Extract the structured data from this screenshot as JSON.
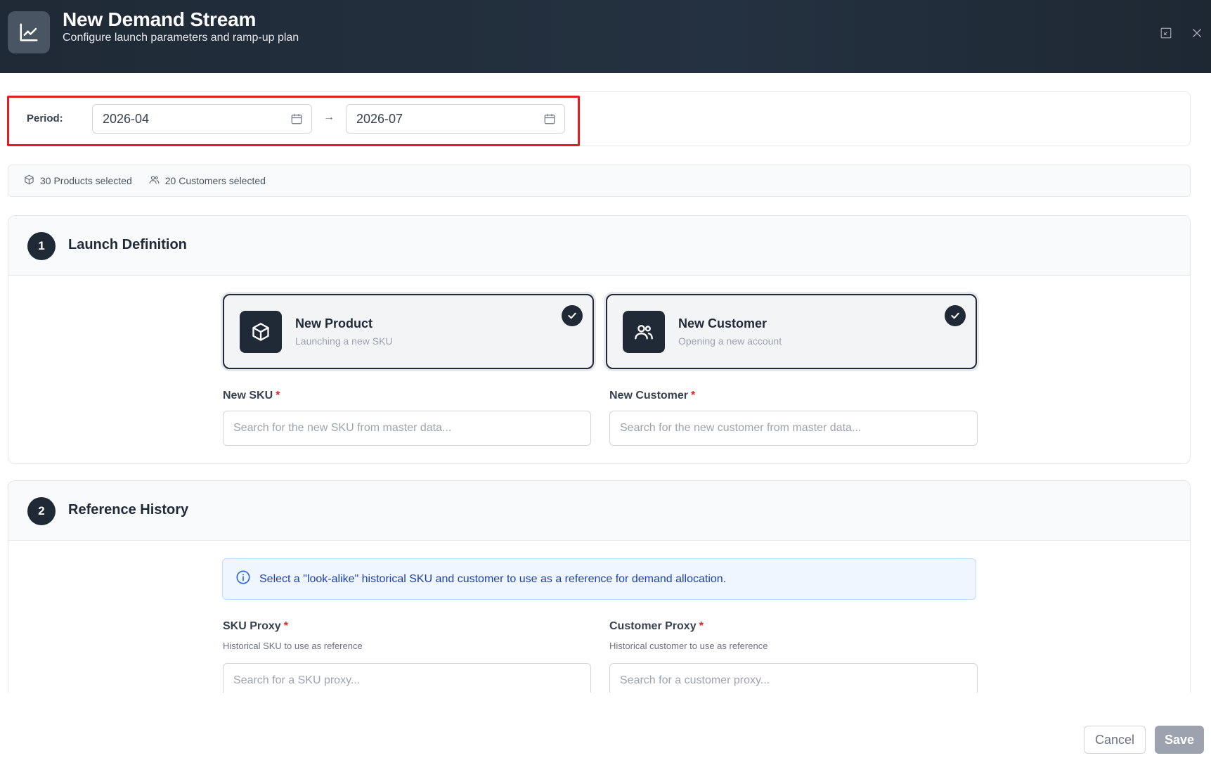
{
  "header": {
    "title": "New Demand Stream",
    "subtitle": "Configure launch parameters and ramp-up plan",
    "icon": "trend-chart-icon"
  },
  "period": {
    "label": "Period:",
    "start": "2026-04",
    "end": "2026-07",
    "separator": "→"
  },
  "selection": {
    "products": "30 Products selected",
    "customers": "20 Customers selected"
  },
  "sections": [
    {
      "number": "1",
      "title": "Launch Definition",
      "choices": [
        {
          "title": "New Product",
          "subtitle": "Launching a new SKU",
          "selected": true
        },
        {
          "title": "New Customer",
          "subtitle": "Opening a new account",
          "selected": true
        }
      ],
      "fields": [
        {
          "label": "New SKU",
          "required": "*",
          "placeholder": "Search for the new SKU from master data..."
        },
        {
          "label": "New Customer",
          "required": "*",
          "placeholder": "Search for the new customer from master data..."
        }
      ]
    },
    {
      "number": "2",
      "title": "Reference History",
      "info": "Select a \"look-alike\" historical SKU and customer to use as a reference for demand allocation.",
      "fields": [
        {
          "label": "SKU Proxy",
          "required": "*",
          "help": "Historical SKU to use as reference",
          "placeholder": "Search for a SKU proxy..."
        },
        {
          "label": "Customer Proxy",
          "required": "*",
          "help": "Historical customer to use as reference",
          "placeholder": "Search for a customer proxy..."
        }
      ]
    }
  ],
  "footer": {
    "cancel": "Cancel",
    "save": "Save"
  },
  "colors": {
    "header_bg": "#1f2a36",
    "highlight": "#e11d23",
    "required": "#dc2626",
    "info_text": "#1e40af"
  }
}
